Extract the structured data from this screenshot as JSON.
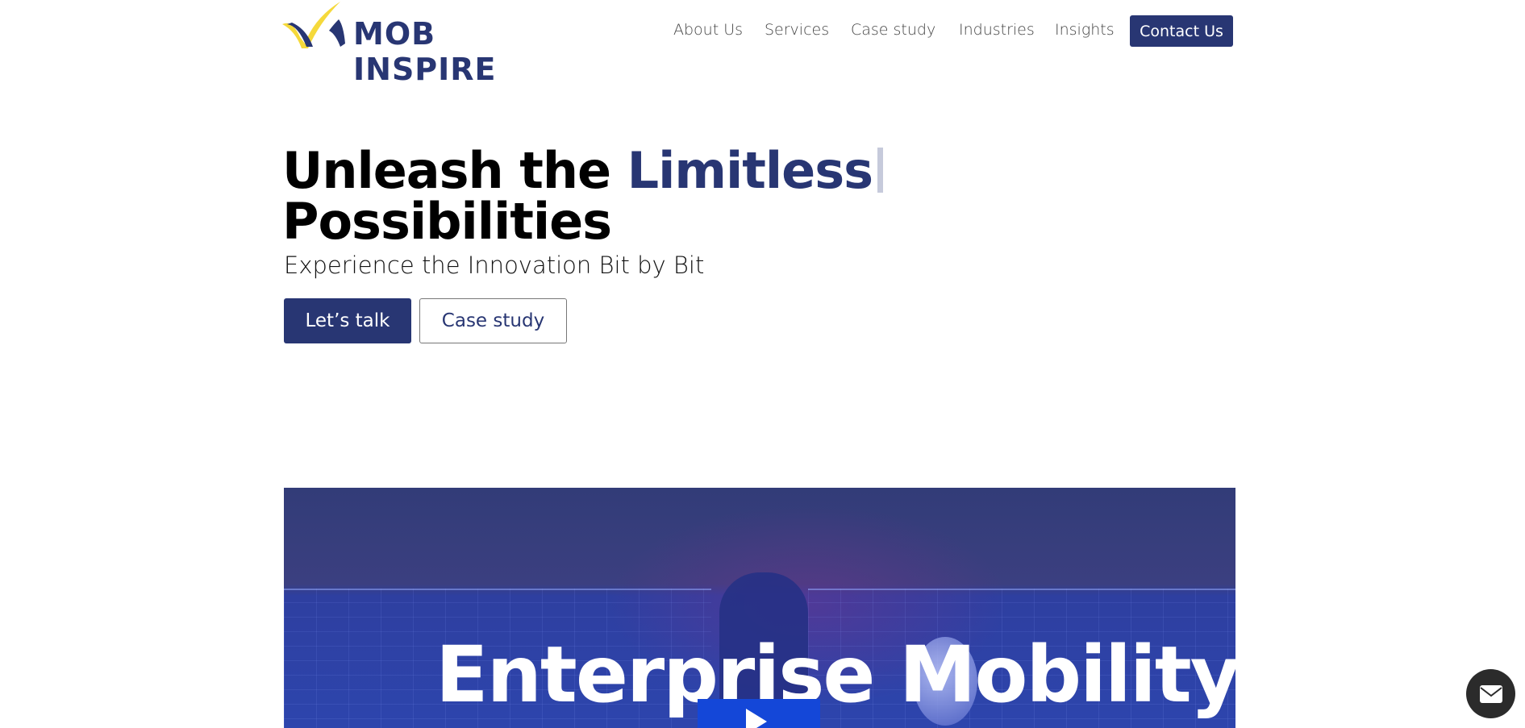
{
  "brand": {
    "name": "MOB INSPIRE",
    "colors": {
      "primary": "#283673",
      "accent": "#f5d93b"
    }
  },
  "nav": {
    "items": [
      {
        "label": "About Us"
      },
      {
        "label": "Services"
      },
      {
        "label": "Case study"
      },
      {
        "label": "Industries"
      },
      {
        "label": "Insights"
      }
    ],
    "contact_label": "Contact Us"
  },
  "hero": {
    "title_part1": "Unleash the ",
    "title_highlight": "Limitless",
    "title_part2": "Possibilities",
    "subtitle": "Experience the Innovation Bit by Bit",
    "primary_button": "Let’s talk",
    "secondary_button": "Case study"
  },
  "video": {
    "title": "Enterprise Mobility",
    "icon": "play-icon"
  },
  "floating": {
    "icon": "mail-icon"
  }
}
